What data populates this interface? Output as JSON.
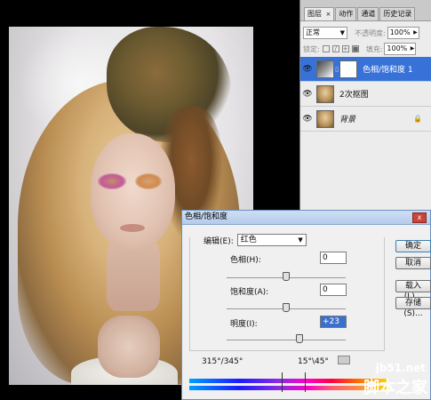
{
  "layers_panel": {
    "tabs": [
      {
        "label": "图层",
        "active": true,
        "close": "×"
      },
      {
        "label": "动作",
        "active": false
      },
      {
        "label": "通道",
        "active": false
      },
      {
        "label": "历史记录",
        "active": false
      }
    ],
    "blend_mode": "正常",
    "opacity_label": "不透明度:",
    "opacity_value": "100%",
    "lock_label": "锁定:",
    "fill_label": "填充:",
    "fill_value": "100%",
    "layers": [
      {
        "name": "色相/饱和度 1",
        "selected": true
      },
      {
        "name": "2次抠图",
        "selected": false
      },
      {
        "name": "背景",
        "selected": false,
        "locked": true
      }
    ]
  },
  "dialog": {
    "title": "色相/饱和度",
    "close": "x",
    "edit_label": "编辑(E):",
    "edit_value": "红色",
    "hue_label": "色相(H):",
    "hue_value": "0",
    "hue_slider": 0.5,
    "saturation_label": "饱和度(A):",
    "saturation_value": "0",
    "saturation_slider": 0.5,
    "lightness_label": "明度(I):",
    "lightness_value": "+23",
    "lightness_slider": 0.615,
    "buttons": {
      "ok": "确定",
      "cancel": "取消",
      "load": "载入(L)...",
      "save": "存储(S)..."
    },
    "range_left": "315°/345°",
    "range_right": "15°\\45°"
  },
  "watermark": {
    "line1": "jb51.net",
    "line2": "脚本之家"
  }
}
